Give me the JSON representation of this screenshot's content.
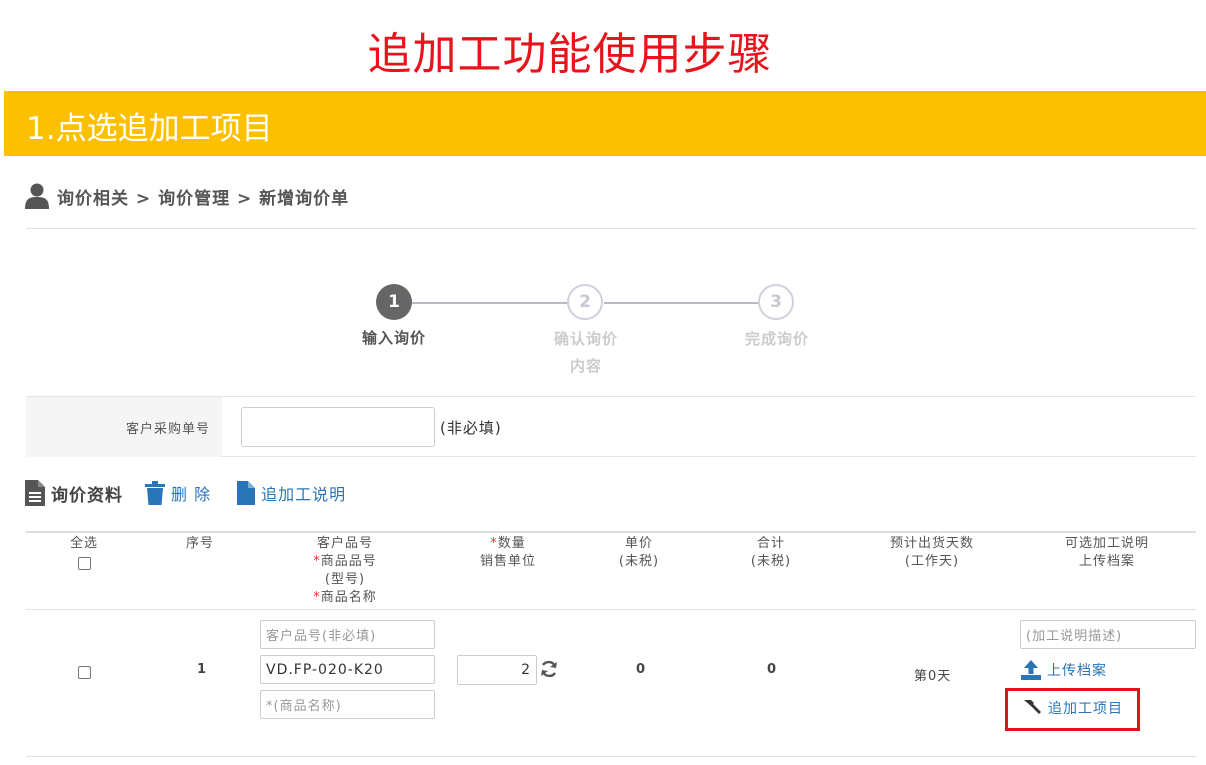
{
  "main_title": "追加工功能使用步骤",
  "banner_title": "1.点选追加工项目",
  "breadcrumb": "询价相关 > 询价管理 > 新增询价单",
  "steps": [
    {
      "num": "1",
      "label_line1": "输入询价",
      "label_line2": ""
    },
    {
      "num": "2",
      "label_line1": "确认询价",
      "label_line2": "内容"
    },
    {
      "num": "3",
      "label_line1": "完成询价",
      "label_line2": ""
    }
  ],
  "po": {
    "label": "客户采购单号",
    "value": "",
    "note": "(非必填)"
  },
  "toolbar": {
    "title": "询价资料",
    "delete": "删 除",
    "addproc_help": "追加工说明"
  },
  "table": {
    "headers": {
      "select_all": "全选",
      "seq": "序号",
      "cust_part": "客户品号",
      "req_mark": "*",
      "prod_part": "商品品号",
      "model": "(型号)",
      "prod_name": "商品名称",
      "qty": "数量",
      "sales_unit": "销售单位",
      "unit_price": "单价",
      "unit_price_tax": "(未税)",
      "total": "合计",
      "total_tax": "(未税)",
      "ship_days": "预计出货天数",
      "ship_days_sub": "(工作天)",
      "proc_desc": "可选加工说明",
      "upload_files": "上传档案"
    },
    "row": {
      "seq": "1",
      "cust_part_placeholder": "客户品号(非必填)",
      "prod_part_value": "VD.FP-020-K20",
      "prod_name_placeholder": "*(商品名称)",
      "qty": "2",
      "unit_price": "0",
      "total": "0",
      "ship_days": "第0天",
      "proc_desc_placeholder": "(加工说明描述)",
      "upload_label": "上传档案",
      "addproc_label": "追加工项目"
    }
  },
  "colors": {
    "title_red": "#e8141c",
    "banner": "#fcc000",
    "link": "#2a74b8",
    "highlight": "#e0141c"
  }
}
